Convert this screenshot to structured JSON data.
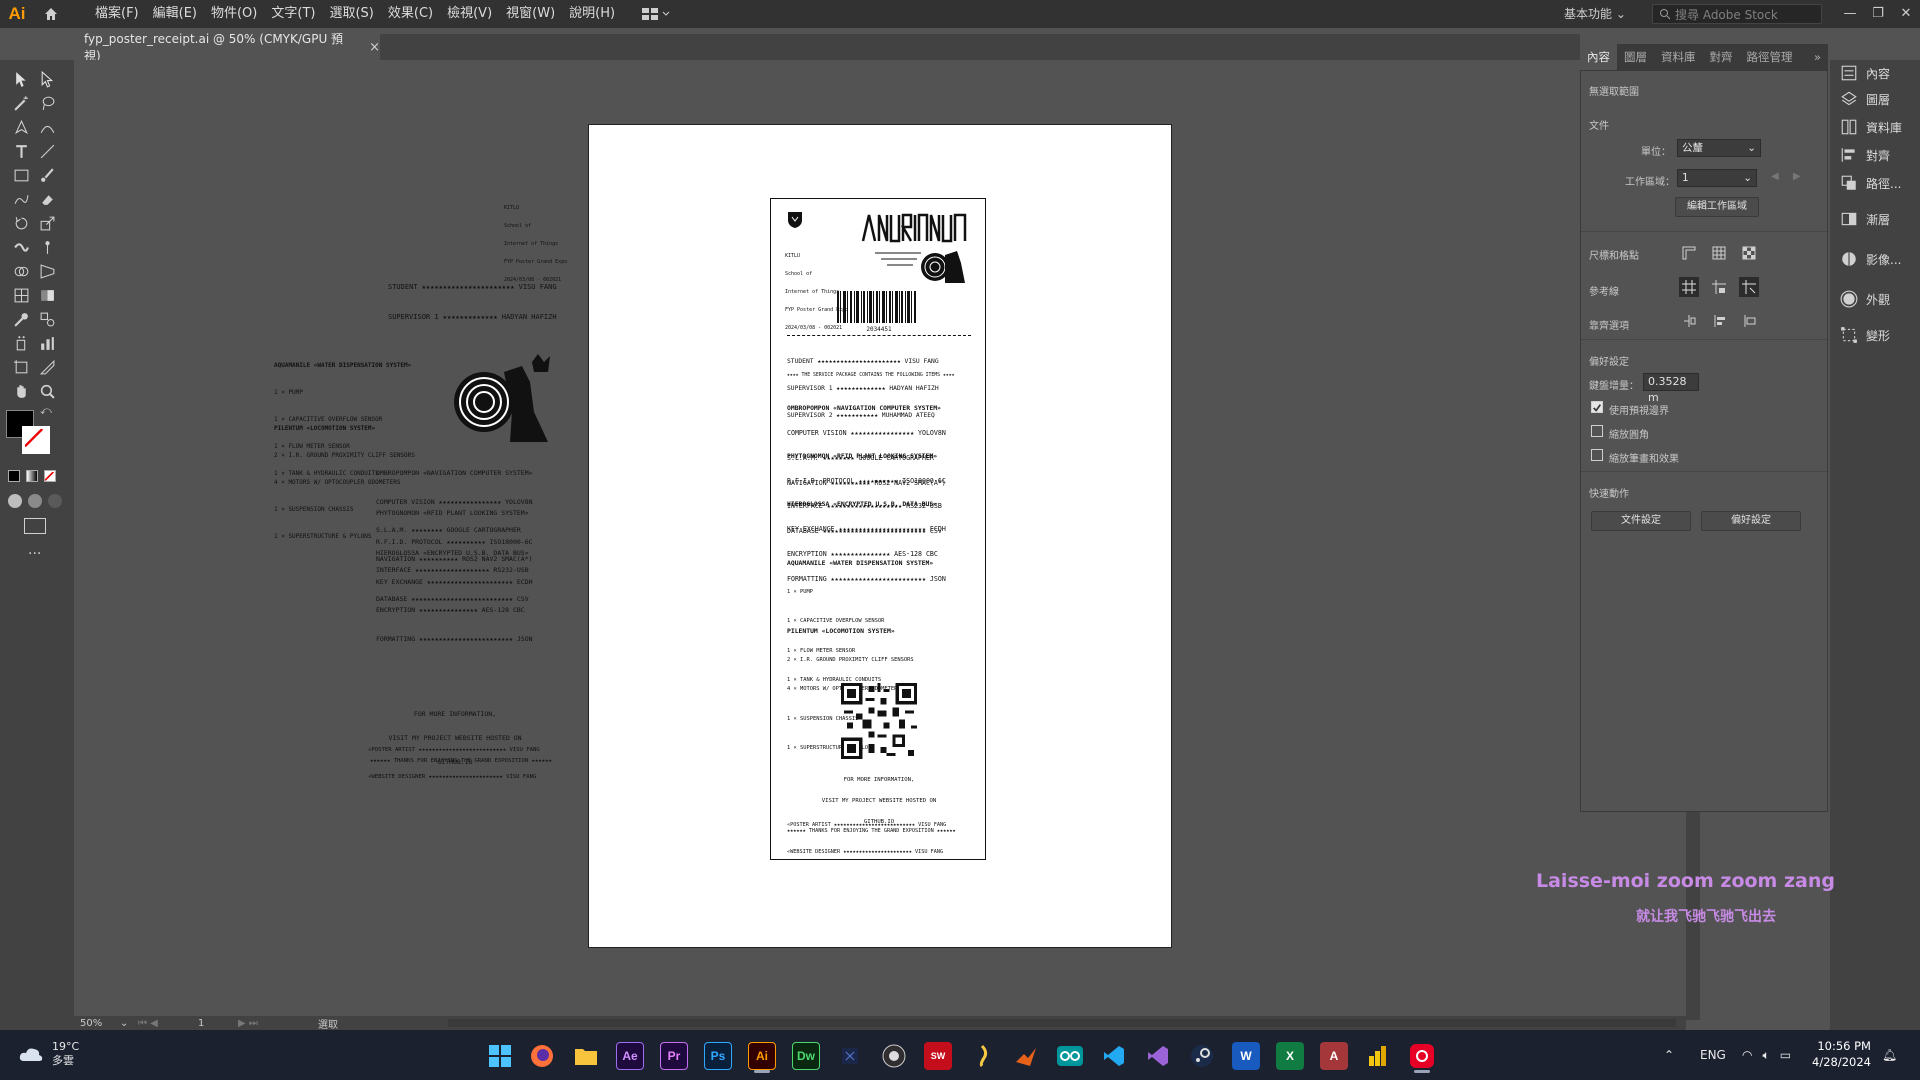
{
  "app": {
    "logo": "Ai",
    "workspace_label": "基本功能",
    "stock_placeholder": "搜尋 Adobe Stock"
  },
  "menu": [
    "檔案(F)",
    "編輯(E)",
    "物件(O)",
    "文字(T)",
    "選取(S)",
    "效果(C)",
    "檢視(V)",
    "視窗(W)",
    "說明(H)"
  ],
  "document_tab": {
    "title": "fyp_poster_receipt.ai @ 50% (CMYK/GPU 預視)",
    "close": "×"
  },
  "receipt": {
    "school": [
      "KITLU",
      "School of",
      "Internet of Things",
      "FYP Poster Grand Expo",
      "2024/03/08 - 002021"
    ],
    "barcode_number": "2034451",
    "people": [
      "STUDENT ★★★★★★★★★★★★★★★★★★★★★★ VISU FANG",
      "SUPERVISOR 1 ★★★★★★★★★★★★★ HADYAN HAFIZH",
      "SUPERVISOR 2 ★★★★★★★★★★★ MUHAMMAD ATEEQ"
    ],
    "package_note": "★★★★ THE SERVICE PACKAGE CONTAINS THE FOLLOWING ITEMS ★★★★",
    "sections": [
      {
        "title": "OMBROPOMPON «NAVIGATION COMPUTER SYSTEM»",
        "lines": [
          "COMPUTER VISION ★★★★★★★★★★★★★★★★ YOLOV8N",
          "S.L.A.M. ★★★★★★★★ GOOGLE CARTOGRAPHER",
          "NAVIGATION ★★★★★★★★★★ ROS2 NAV2 SMAC(A*)"
        ]
      },
      {
        "title": "PHYTOGNOMON «RFID PLANT LOOKING SYSTEM»",
        "lines": [
          "R.F.I.D. PROTOCOL ★★★★★★★★★★ ISO18000-6C",
          "INTERFACE ★★★★★★★★★★★★★★★★★★★ RS232-USB",
          "DATABASE ★★★★★★★★★★★★★★★★★★★★★★★★★★ CSV"
        ]
      },
      {
        "title": "HIEROGLOSSA «ENCRYPTED U.S.B. DATA BUS»",
        "lines": [
          "KEY EXCHANGE ★★★★★★★★★★★★★★★★★★★★★★ ECDH",
          "ENCRYPTION ★★★★★★★★★★★★★★★ AES-128 CBC",
          "FORMATTING ★★★★★★★★★★★★★★★★★★★★★★★★ JSON"
        ]
      },
      {
        "title": "AQUAMANILE «WATER DISPENSATION SYSTEM»",
        "lines": [
          "1 × PUMP",
          "1 × CAPACITIVE OVERFLOW SENSOR",
          "1 × FLOW METER SENSOR",
          "1 × TANK & HYDRAULIC CONDUITS"
        ]
      },
      {
        "title": "PILENTUM «LOCOMOTION SYSTEM»",
        "lines": [
          "2 × I.R. GROUND PROXIMITY CLIFF SENSORS",
          "4 × MOTORS W/ OPTOCOUPLER ODOMETERS",
          "1 × SUSPENSION CHASSIS",
          "1 × SUPERSTRUCTURE & PYLONS"
        ]
      }
    ],
    "info": [
      "FOR MORE INFORMATION,",
      "VISIT MY PROJECT WEBSITE HOSTED ON",
      "GITHUB.IO"
    ],
    "credits": [
      "«POSTER ARTIST ★★★★★★★★★★★★★★★★★★★★★★★★★★ VISU FANG",
      "«WEBSITE DESIGNER ★★★★★★★★★★★★★★★★★★★★★★ VISU FANG"
    ],
    "thanks": "★★★★★★ THANKS FOR ENJOYING THE GRAND EXPOSITION ★★★★★★"
  },
  "right_tabs": [
    "內容",
    "圖層",
    "資料庫",
    "對齊",
    "路徑管理"
  ],
  "properties": {
    "no_selection": "無選取範圍",
    "document_header": "文件",
    "unit_label": "單位：",
    "unit_value": "公釐",
    "artboard_label": "工作區域：",
    "artboard_value": "1",
    "edit_artboard_btn": "編輯工作區域",
    "rulers_grid": "尺標和格點",
    "guides": "參考線",
    "snap": "靠齊選項",
    "prefs_header": "偏好設定",
    "keyboard_increment_label": "鍵盤增量：",
    "keyboard_increment_value": "0.3528 m",
    "use_preview_bounds": "使用預視邊界",
    "scale_corners": "縮放圓角",
    "scale_strokes": "縮放筆畫和效果",
    "quick_actions": "快速動作",
    "doc_setup_btn": "文件設定",
    "prefs_btn": "偏好設定"
  },
  "far_panel": [
    "內容",
    "圖層",
    "資料庫",
    "對齊",
    "路徑...",
    "漸層",
    "影像...",
    "外觀",
    "變形"
  ],
  "status": {
    "zoom": "50%",
    "artboard": "1",
    "selection": "選取"
  },
  "lyrics": {
    "line1": "Laisse-moi zoom zoom zang",
    "line2": "就让我飞驰飞驰飞出去"
  },
  "taskbar": {
    "temp": "19°C",
    "weather": "多雲",
    "lang": "ENG",
    "time": "10:56 PM",
    "date": "4/28/2024",
    "apps": [
      "Ae",
      "Pr",
      "Ps",
      "Ai",
      "Dw"
    ]
  },
  "colors": {
    "accent": "#ff9a00",
    "lyrics": "#c78be6"
  }
}
